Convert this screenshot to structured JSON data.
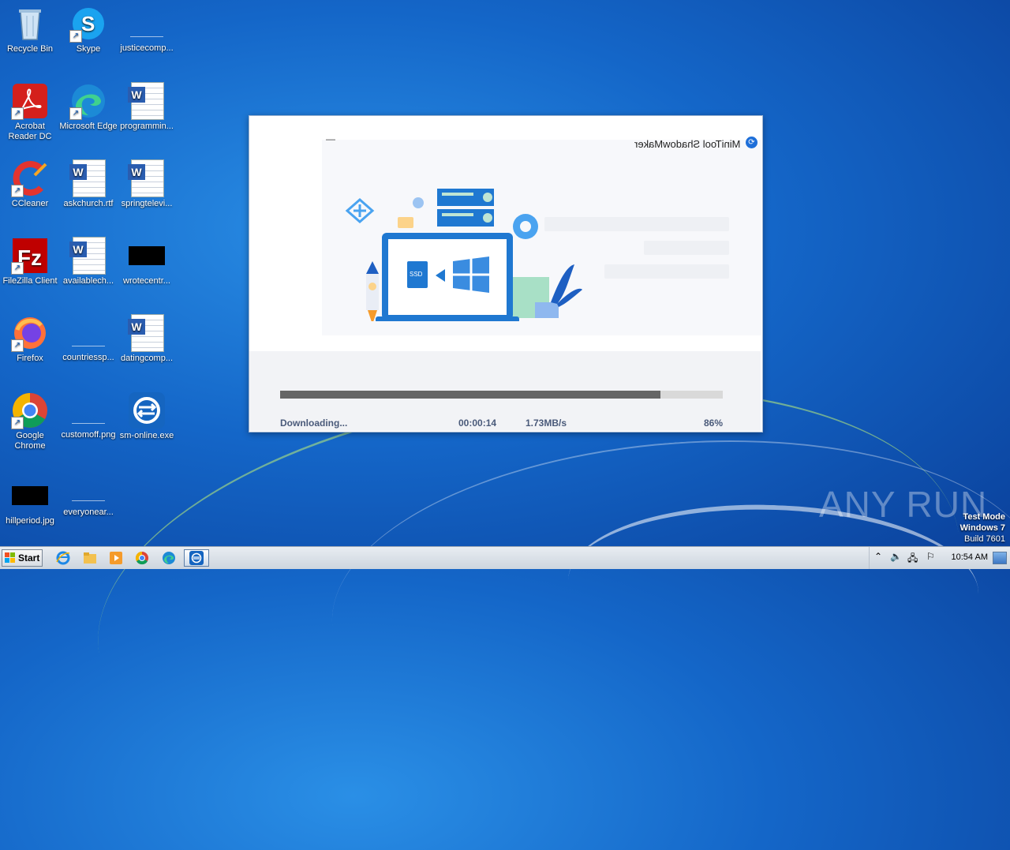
{
  "desktop": {
    "icons": [
      {
        "label": "Recycle Bin"
      },
      {
        "label": "Skype"
      },
      {
        "label": "justicecomp..."
      },
      {
        "label": "Acrobat Reader DC"
      },
      {
        "label": "Microsoft Edge"
      },
      {
        "label": "programmin..."
      },
      {
        "label": "CCleaner"
      },
      {
        "label": "askchurch.rtf"
      },
      {
        "label": "springtelevi..."
      },
      {
        "label": "FileZilla Client"
      },
      {
        "label": "availablech..."
      },
      {
        "label": "wrotecentr..."
      },
      {
        "label": "Firefox"
      },
      {
        "label": "countriessp..."
      },
      {
        "label": "datingcomp..."
      },
      {
        "label": "Google Chrome"
      },
      {
        "label": "customoff.png"
      },
      {
        "label": "sm-online.exe"
      },
      {
        "label": "hillperiod.jpg"
      },
      {
        "label": "everyonear..."
      }
    ]
  },
  "dialog": {
    "title": "MiniTool ShadowMaker",
    "minimize": "—",
    "screen_labels": {
      "ssd": "SSD"
    },
    "progress_fraction": 0.86,
    "status_text": "Downloading...",
    "elapsed": "00:00:14",
    "speed": "1.73MB/s",
    "percent": "86%"
  },
  "taskbar": {
    "start_label": "Start",
    "clock": "10:54 AM"
  },
  "watermark": "ANY RUN",
  "os_overlay": {
    "line1": "Test Mode",
    "line2": "Windows 7",
    "line3": "Build 7601"
  },
  "colors": {
    "accent": "#1e6fd9",
    "progress_fill": "#666666",
    "progress_track": "#d9d9d9",
    "status_text": "#4a5a7a"
  }
}
